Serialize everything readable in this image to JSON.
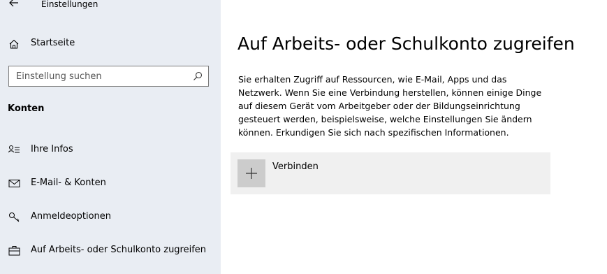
{
  "window": {
    "title": "Einstellungen"
  },
  "sidebar": {
    "home_label": "Startseite",
    "search_placeholder": "Einstellung suchen",
    "section_title": "Konten",
    "items": [
      {
        "label": "Ihre Infos",
        "icon": "person-list-icon"
      },
      {
        "label": "E-Mail- & Konten",
        "icon": "mail-icon"
      },
      {
        "label": "Anmeldeoptionen",
        "icon": "key-icon"
      },
      {
        "label": "Auf Arbeits- oder Schulkonto zugreifen",
        "icon": "briefcase-icon"
      }
    ]
  },
  "main": {
    "title": "Auf Arbeits- oder Schulkonto zugreifen",
    "description": "Sie erhalten Zugriff auf Ressourcen, wie E-Mail, Apps und das Netzwerk. Wenn Sie eine Verbindung herstellen, können einige Dinge auf diesem Gerät vom Arbeitgeber oder der Bildungseinrichtung gesteuert werden, beispielsweise, welche Einstellungen Sie ändern können. Erkundigen Sie sich nach spezifischen Informationen.",
    "connect_label": "Verbinden"
  }
}
